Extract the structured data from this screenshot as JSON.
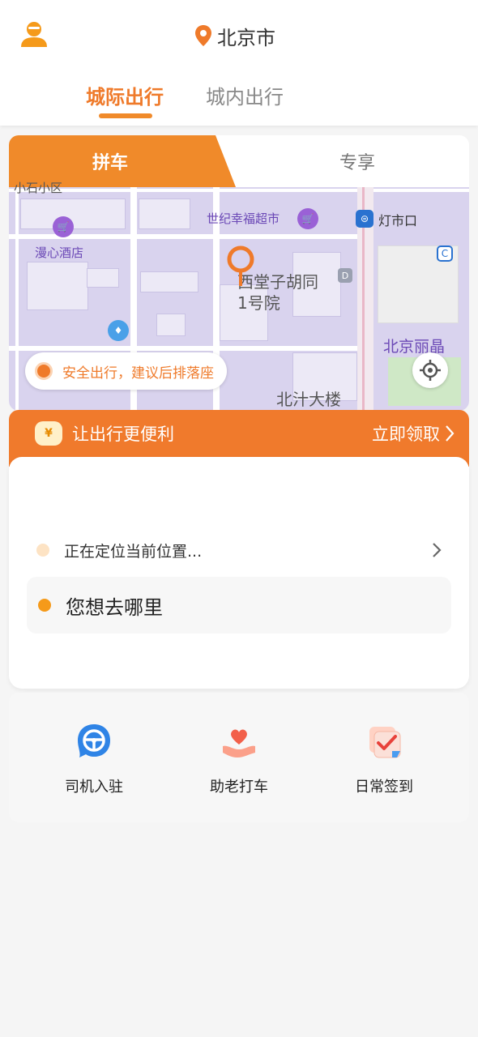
{
  "header": {
    "city": "北京市",
    "tabs": [
      {
        "label": "城际出行",
        "active": true
      },
      {
        "label": "城内出行",
        "active": false
      }
    ]
  },
  "mode_tabs": [
    {
      "label": "拼车",
      "active": true
    },
    {
      "label": "专享",
      "active": false
    }
  ],
  "map": {
    "labels": {
      "top_partial": "小石小区",
      "supermarket": "世纪幸福超市",
      "subway": "灯市口",
      "hotel": "漫心酒店",
      "location": "西堂子胡同1号院",
      "right": "北京丽晶",
      "bottom": "北汁大楼"
    },
    "notice": "安全出行，建议后排落座"
  },
  "promo": {
    "title": "让出行更便利",
    "action": "立即领取",
    "coupon_symbol": "¥"
  },
  "trip": {
    "from_placeholder": "正在定位当前位置...",
    "to_placeholder": "您想去哪里"
  },
  "services": [
    {
      "label": "司机入驻",
      "icon": "steering-wheel-icon"
    },
    {
      "label": "助老打车",
      "icon": "heart-hand-icon"
    },
    {
      "label": "日常签到",
      "icon": "calendar-check-icon"
    }
  ],
  "colors": {
    "accent": "#f08a2a",
    "map_bg": "#d9d3ee"
  }
}
